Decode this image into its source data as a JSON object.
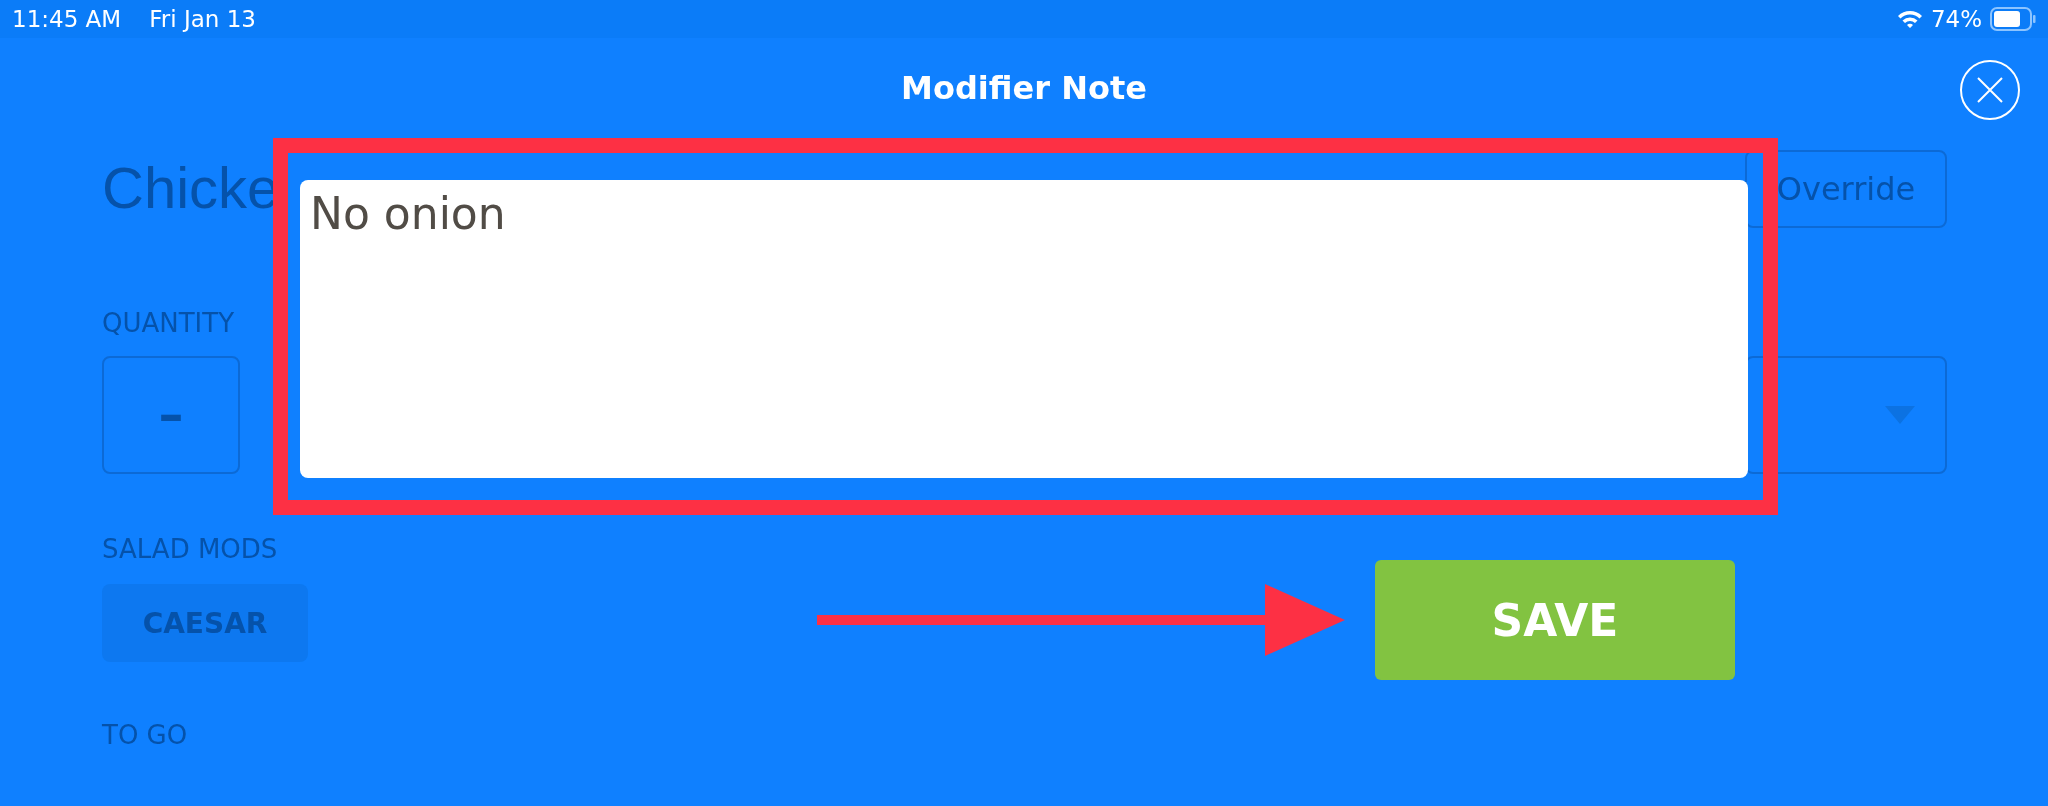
{
  "status_bar": {
    "time": "11:45 AM",
    "date": "Fri Jan 13",
    "battery": "74%"
  },
  "background": {
    "item_title": "Chicke",
    "override_button": "Override",
    "quantity_label": "QUANTITY",
    "minus_button": "–",
    "salad_mods_label": "SALAD MODS",
    "mod_options": [
      {
        "label": "CAESAR",
        "selected": false
      }
    ],
    "to_go_label": "TO GO"
  },
  "dialog": {
    "title": "Modifier Note",
    "note_value": "No onion",
    "save_button": "SAVE"
  }
}
